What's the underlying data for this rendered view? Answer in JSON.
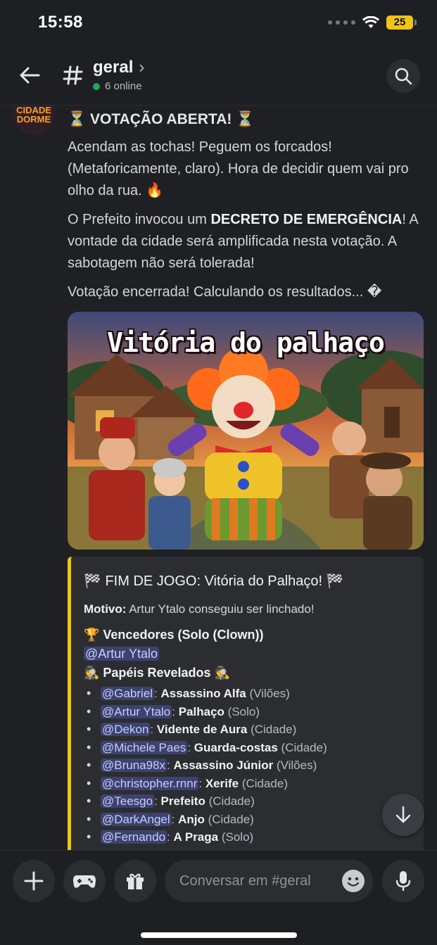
{
  "status_bar": {
    "time": "15:58",
    "battery": "25"
  },
  "header": {
    "channel": "geral",
    "chevron": "›",
    "online": "6 online"
  },
  "avatar": {
    "label_line1": "CIDADE",
    "label_line2": "DORME"
  },
  "message": {
    "title": "⏳ VOTAÇÃO ABERTA! ⏳",
    "para1": "Acendam as tochas! Peguem os forcados! (Metaforicamente, claro). Hora de decidir quem vai pro olho da rua. 🔥",
    "para2_pre": "O Prefeito invocou um ",
    "para2_bold": "DECRETO DE EMERGÊNCIA",
    "para2_post": "! A vontade da cidade será amplificada nesta votação. A sabotagem não será tolerada!",
    "para3": "Votação encerrada! Calculando os resultados... �",
    "image_title": "Vitória do palhaço"
  },
  "embed": {
    "title": "🏁 FIM DE JOGO: Vitória do Palhaço! 🏁",
    "reason_label": "Motivo:",
    "reason_text": " Artur Ytalo conseguiu ser linchado!",
    "winners_heading": "🏆 Vencedores (Solo (Clown))",
    "winner": "@Artur Ytalo",
    "roles_heading": "🕵 Papéis Revelados 🕵",
    "roles": [
      {
        "user": "@Gabriel",
        "role": "Assassino Alfa",
        "team": "(Vilões)"
      },
      {
        "user": "@Artur Ytalo",
        "role": "Palhaço",
        "team": "(Solo)"
      },
      {
        "user": "@Dekon",
        "role": "Vidente de Aura",
        "team": "(Cidade)"
      },
      {
        "user": "@Michele Paes",
        "role": "Guarda-costas",
        "team": "(Cidade)"
      },
      {
        "user": "@Bruna98x",
        "role": "Assassino Júnior",
        "team": "(Vilões)"
      },
      {
        "user": "@christopher.rnnr",
        "role": "Xerife",
        "team": "(Cidade)"
      },
      {
        "user": "@Teesgo",
        "role": "Prefeito",
        "team": "(Cidade)"
      },
      {
        "user": "@DarkAngel",
        "role": "Anjo",
        "team": "(Cidade)"
      },
      {
        "user": "@Fernando",
        "role": "A Praga",
        "team": "(Solo)"
      }
    ]
  },
  "composer": {
    "placeholder": "Conversar em #geral"
  },
  "colors": {
    "accent_embed": "#f0c419",
    "mention_bg": "#3c4270",
    "online": "#23a55a"
  }
}
